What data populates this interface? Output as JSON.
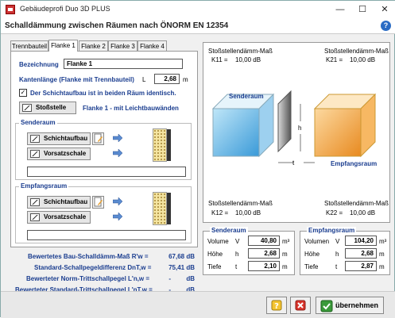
{
  "window": {
    "title": "Gebäudeprofi Duo 3D PLUS",
    "min": "—",
    "max": "☐",
    "close": "✕"
  },
  "header": {
    "title": "Schalldämmung zwischen Räumen nach ÖNORM EN 12354",
    "help": "?"
  },
  "tabs": [
    "Trennbauteil",
    "Flanke 1",
    "Flanke 2",
    "Flanke 3",
    "Flanke 4"
  ],
  "active_tab": "Flanke 1",
  "flanke": {
    "bezeichnung_label": "Bezeichnung",
    "bezeichnung_value": "Flanke 1",
    "kantenlaenge_label": "Kantenlänge (Flanke mit Trennbauteil)",
    "kantenlaenge_symbol": "L",
    "kantenlaenge_value": "2,68",
    "kantenlaenge_unit": "m",
    "checkbox_label": "Der Schichtaufbau ist in beiden Räum identisch.",
    "checkbox_checked": "✓",
    "stossstelle_button": "Stoßstelle",
    "stossstelle_info": "Flanke 1 - mit Leichtbauwänden"
  },
  "senderaum": {
    "title": "Senderaum",
    "schichtaufbau": "Schichtaufbau",
    "vorsatzschale": "Vorsatzschale",
    "input_value": ""
  },
  "empfangsraum": {
    "title": "Empfangsraum",
    "schichtaufbau": "Schichtaufbau",
    "vorsatzschale": "Vorsatzschale",
    "input_value": ""
  },
  "results": [
    {
      "label": "Bewertetes Bau-Schalldämm-Maß R'w =",
      "value": "67,68 dB"
    },
    {
      "label": "Standard-Schallpegeldifferenz DnT,w =",
      "value": "75,41 dB"
    },
    {
      "label": "Bewerteter Norm-Trittschallpegel L'n,w =",
      "value": "-",
      "unit": "dB"
    },
    {
      "label": "Bewerteter Standard-Trittschallpegel L'nT,w =",
      "value": "-",
      "unit": "dB"
    }
  ],
  "diagram": {
    "top_left": {
      "title": "Stoßstellendämm-Maß",
      "symbol": "K11 =",
      "value": "10,00 dB"
    },
    "top_right": {
      "title": "Stoßstellendämm-Maß",
      "symbol": "K21 =",
      "value": "10,00 dB"
    },
    "bottom_left": {
      "title": "Stoßstellendämm-Maß",
      "symbol": "K12 =",
      "value": "10,00 dB"
    },
    "bottom_right": {
      "title": "Stoßstellendämm-Maß",
      "symbol": "K22 =",
      "value": "10,00 dB"
    },
    "senderaum_label": "Senderaum",
    "empfangsraum_label": "Empfangsraum",
    "h_label": "h",
    "t_label": "t",
    "colors": {
      "sender": "#4aa8e0",
      "empfang": "#f0a030",
      "wall": "#888888"
    }
  },
  "sender_dims": {
    "title": "Senderaum",
    "rows": [
      {
        "label": "Volume",
        "symbol": "V",
        "value": "40,80",
        "unit": "m³"
      },
      {
        "label": "Höhe",
        "symbol": "h",
        "value": "2,68",
        "unit": "m"
      },
      {
        "label": "Tiefe",
        "symbol": "t",
        "value": "2,10",
        "unit": "m"
      }
    ]
  },
  "empfang_dims": {
    "title": "Empfangsraum",
    "rows": [
      {
        "label": "Volumen",
        "symbol": "V",
        "value": "104,20",
        "unit": "m³"
      },
      {
        "label": "Höhe",
        "symbol": "h",
        "value": "2,68",
        "unit": "m"
      },
      {
        "label": "Tiefe",
        "symbol": "t",
        "value": "2,87",
        "unit": "m"
      }
    ]
  },
  "footer": {
    "ok_label": "übernehmen"
  }
}
